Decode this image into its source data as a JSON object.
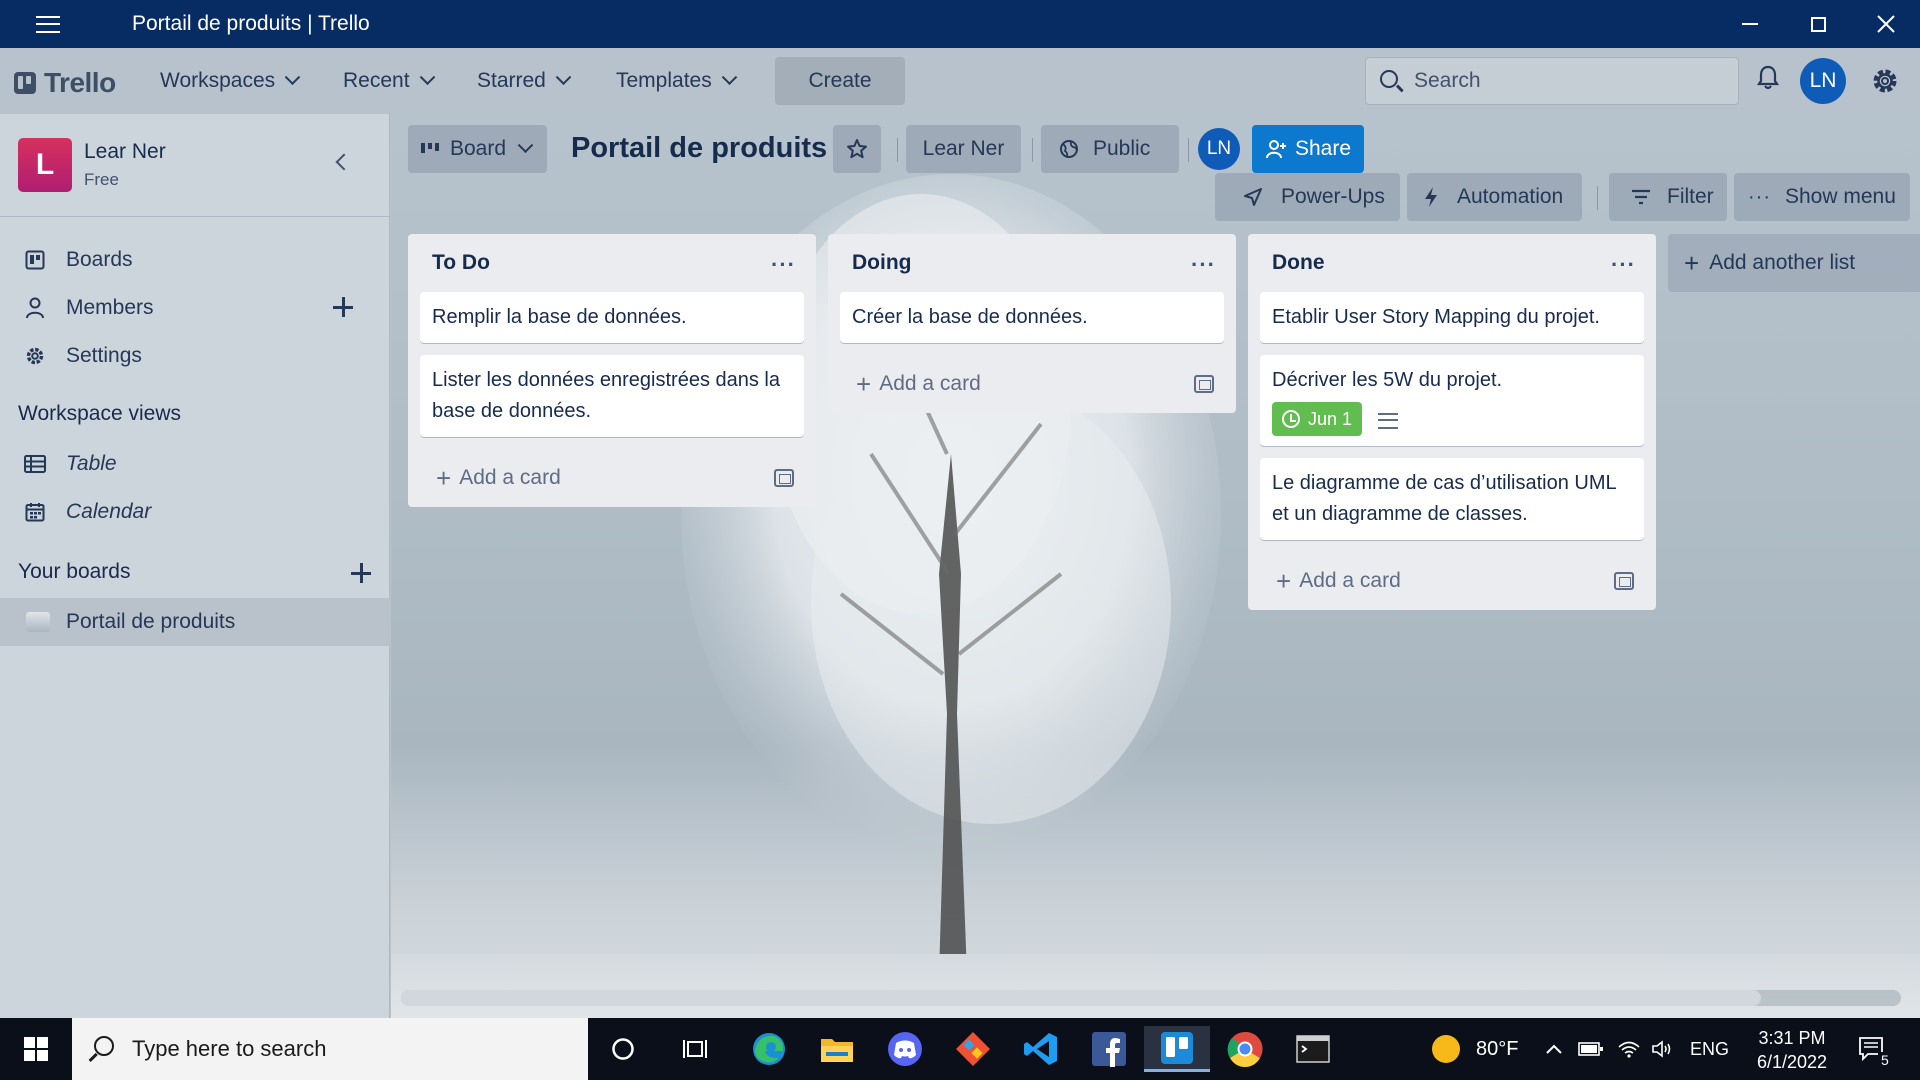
{
  "window": {
    "title": "Portail de produits | Trello"
  },
  "header": {
    "logo_text": "Trello",
    "nav": [
      "Workspaces",
      "Recent",
      "Starred",
      "Templates"
    ],
    "create_label": "Create",
    "search_placeholder": "Search",
    "user_initials": "LN"
  },
  "sidebar": {
    "workspace_initial": "L",
    "workspace_name": "Lear Ner",
    "workspace_plan": "Free",
    "items": [
      {
        "label": "Boards",
        "icon": "board-icon"
      },
      {
        "label": "Members",
        "icon": "person-icon"
      },
      {
        "label": "Settings",
        "icon": "gear-icon"
      }
    ],
    "workspace_views_heading": "Workspace views",
    "views": [
      {
        "label": "Table",
        "icon": "table-icon"
      },
      {
        "label": "Calendar",
        "icon": "calendar-icon"
      }
    ],
    "your_boards_heading": "Your boards",
    "boards": [
      "Portail de produits"
    ]
  },
  "board": {
    "view_label": "Board",
    "title": "Portail de produits",
    "workspace_label": "Lear Ner",
    "visibility_label": "Public",
    "member_initials": "LN",
    "share_label": "Share",
    "powerups_label": "Power-Ups",
    "automation_label": "Automation",
    "filter_label": "Filter",
    "show_menu_label": "Show menu",
    "add_list_label": "Add another list",
    "add_card_label": "Add a card",
    "lists": [
      {
        "name": "To Do",
        "cards": [
          "Remplir la base de données.",
          "Lister les données enregistrées dans la base de données."
        ]
      },
      {
        "name": "Doing",
        "cards": [
          "Créer la base de données."
        ]
      },
      {
        "name": "Done",
        "cards": [
          "Etablir User Story Mapping du projet.",
          "Décriver les 5W du projet.",
          "Le diagramme de cas d’utilisation UML et un diagramme de classes."
        ],
        "due_badge": "Jun 1"
      }
    ]
  },
  "taskbar": {
    "search_placeholder": "Type here to search",
    "weather": "80°F",
    "language": "ENG",
    "time": "3:31 PM",
    "date": "6/1/2022",
    "notification_count": "5",
    "apps": [
      "cortana-icon",
      "task-view-icon",
      "edge-icon",
      "file-explorer-icon",
      "discord-icon",
      "git-icon",
      "vscode-icon",
      "facebook-icon",
      "trello-icon",
      "chrome-icon",
      "terminal-icon"
    ]
  },
  "colors": {
    "titlebar": "#072c64",
    "share_button": "#0c79cf",
    "avatar": "#0e5cb7",
    "workspace_logo": "#c2245f",
    "due_badge": "#61bd4f"
  }
}
